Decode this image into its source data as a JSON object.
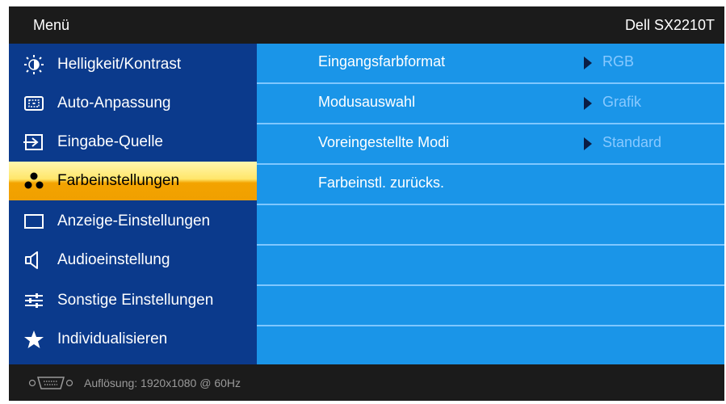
{
  "titlebar": {
    "menu_label": "Menü",
    "model": "Dell SX2210T"
  },
  "sidebar": {
    "items": [
      {
        "label": "Helligkeit/Kontrast",
        "icon": "brightness-icon"
      },
      {
        "label": "Auto-Anpassung",
        "icon": "auto-adjust-icon"
      },
      {
        "label": "Eingabe-Quelle",
        "icon": "input-source-icon"
      },
      {
        "label": "Farbeinstellungen",
        "icon": "color-settings-icon",
        "selected": true
      },
      {
        "label": "Anzeige-Einstellungen",
        "icon": "display-settings-icon"
      },
      {
        "label": "Audioeinstellung",
        "icon": "speaker-icon"
      },
      {
        "label": "Sonstige Einstellungen",
        "icon": "other-settings-icon"
      },
      {
        "label": "Individualisieren",
        "icon": "star-icon"
      }
    ]
  },
  "main": {
    "rows": [
      {
        "label": "Eingangsfarbformat",
        "value": "RGB"
      },
      {
        "label": "Modusauswahl",
        "value": "Grafik"
      },
      {
        "label": "Voreingestellte Modi",
        "value": "Standard"
      },
      {
        "label": "Farbeinstl. zurücks.",
        "value": ""
      }
    ]
  },
  "footer": {
    "resolution_text": "Auflösung: 1920x1080 @ 60Hz",
    "icon": "vga-connector-icon"
  },
  "colors": {
    "sidebar_bg": "#0b3a8c",
    "content_bg": "#1a95e8",
    "selected": "#f0a000",
    "value_text": "#88c9ff"
  }
}
